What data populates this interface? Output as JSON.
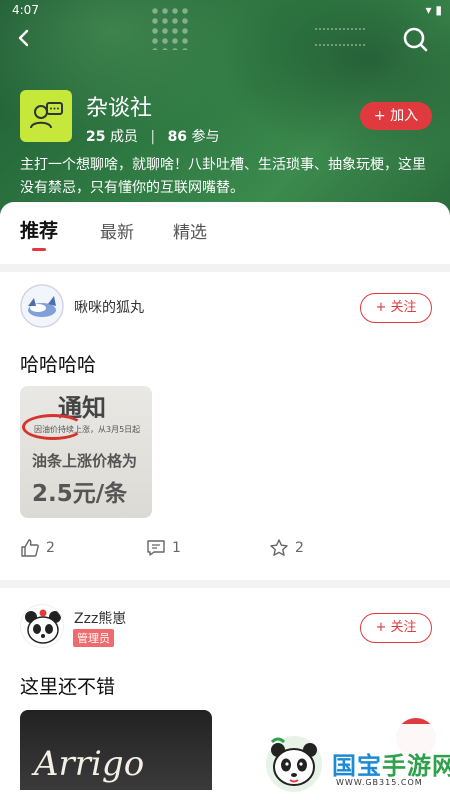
{
  "status_bar": {
    "time": "4:07"
  },
  "header": {
    "group_name": "杂谈社",
    "members_count": "25",
    "members_label": "成员",
    "participants_count": "86",
    "participants_label": "参与",
    "join_label": "+ 加入",
    "description": "主打一个想聊啥，就聊啥！八卦吐槽、生活琐事、抽象玩梗，这里没有禁忌，只有懂你的互联网嘴替。"
  },
  "tabs": [
    {
      "label": "推荐",
      "active": true
    },
    {
      "label": "最新",
      "active": false
    },
    {
      "label": "精选",
      "active": false
    }
  ],
  "posts": [
    {
      "author": "啾咪的狐丸",
      "follow_label": "+ 关注",
      "title": "哈哈哈哈",
      "image_text": {
        "title": "通知",
        "sub": "因油价持续上涨，从3月5日起",
        "line1": "油条上涨价格为",
        "line2": "2.5元/条"
      },
      "likes": "2",
      "comments": "1",
      "favorites": "2"
    },
    {
      "author": "Zzz熊崽",
      "badge": "管理员",
      "follow_label": "+ 关注",
      "title": "这里还不错",
      "image_text": "Arrigo"
    }
  ],
  "watermark": {
    "text_a": "国宝",
    "text_b": "手游网",
    "url": "WWW.GB315.COM"
  },
  "colors": {
    "accent": "#e03a3e",
    "header_green": "#2f7a43",
    "icon_lime": "#c6e83a"
  }
}
